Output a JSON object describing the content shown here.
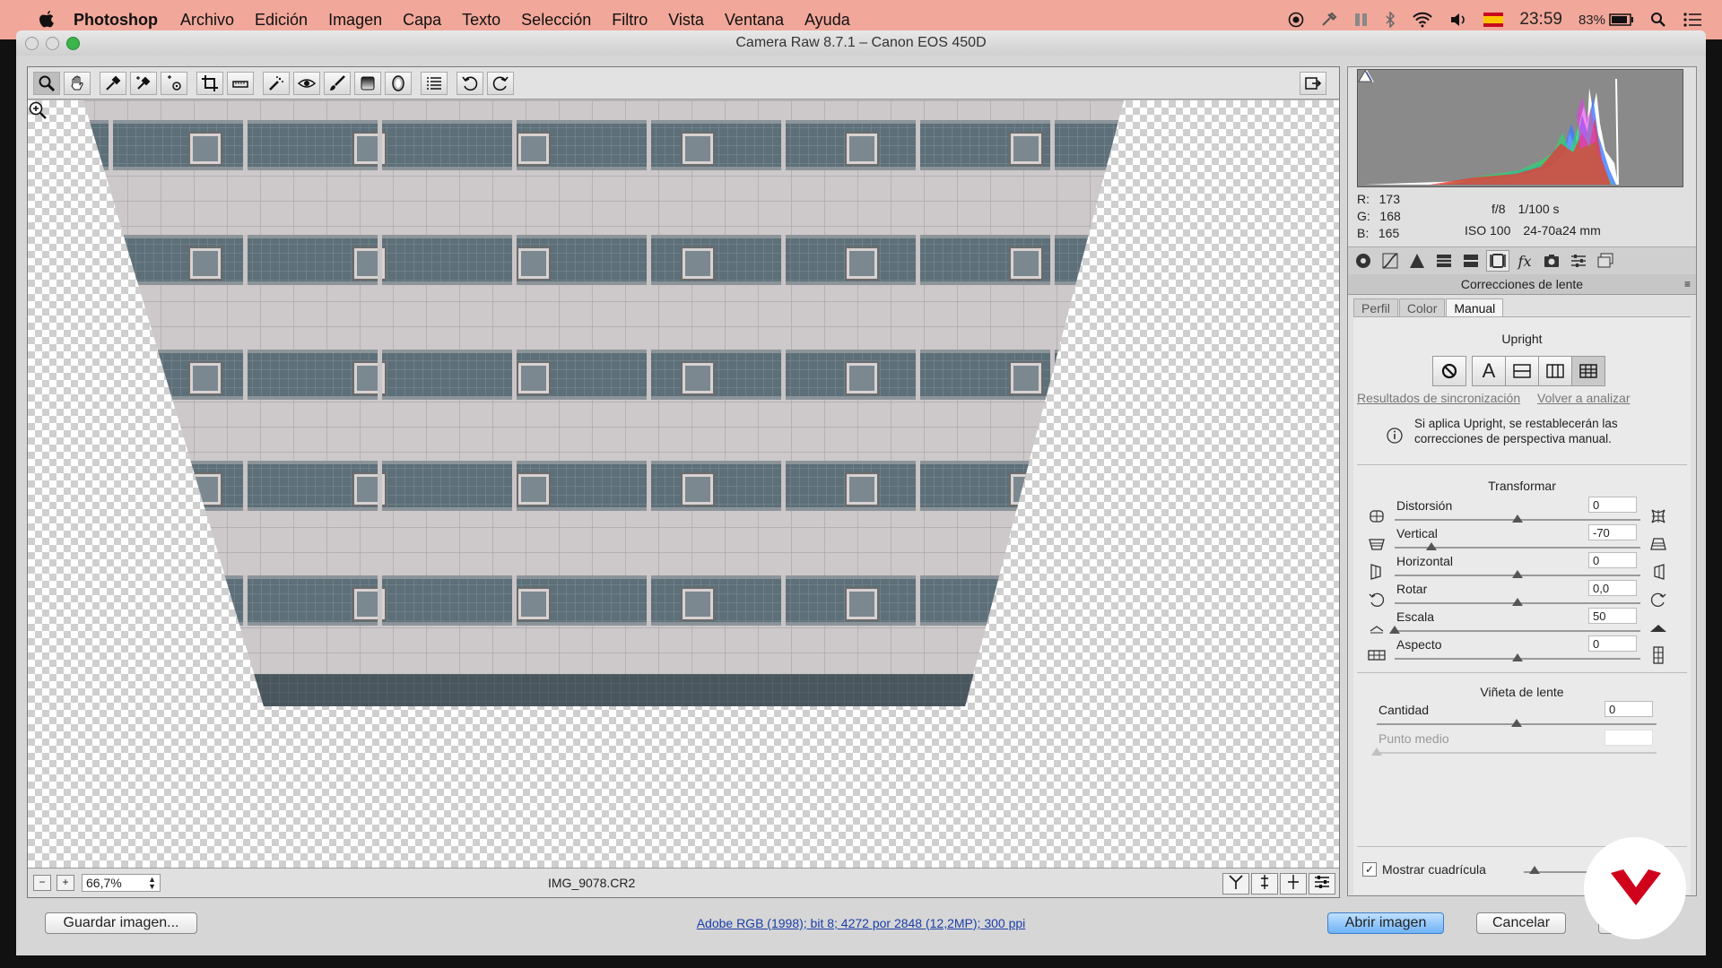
{
  "menubar": {
    "app_name": "Photoshop",
    "items": [
      "Archivo",
      "Edición",
      "Imagen",
      "Capa",
      "Texto",
      "Selección",
      "Filtro",
      "Vista",
      "Ventana",
      "Ayuda"
    ],
    "clock": "23:59",
    "battery": "83%"
  },
  "window": {
    "title": "Camera Raw 8.7.1 –  Canon EOS 450D"
  },
  "preview": {
    "zoom": "66,7%",
    "filename": "IMG_9078.CR2"
  },
  "readout": {
    "r_label": "R:",
    "r": "173",
    "g_label": "G:",
    "g": "168",
    "b_label": "B:",
    "b": "165",
    "aperture": "f/8",
    "shutter": "1/100 s",
    "iso": "ISO 100",
    "lens": "24-70a24 mm"
  },
  "panel": {
    "section_title": "Correcciones de lente",
    "subtabs": [
      "Perfil",
      "Color",
      "Manual"
    ],
    "upright_title": "Upright",
    "sync_link": "Resultados de sincronización",
    "reanalyze_link": "Volver a analizar",
    "info_text": "Si aplica Upright, se restablecerán las correcciones de perspectiva manual.",
    "transform_title": "Transformar",
    "sliders": [
      {
        "label": "Distorsión",
        "value": "0",
        "level": 0.5
      },
      {
        "label": "Vertical",
        "value": "-70",
        "level": 0.15
      },
      {
        "label": "Horizontal",
        "value": "0",
        "level": 0.5
      },
      {
        "label": "Rotar",
        "value": "0,0",
        "level": 0.5
      },
      {
        "label": "Escala",
        "value": "50",
        "level": 0.0
      },
      {
        "label": "Aspecto",
        "value": "0",
        "level": 0.5
      }
    ],
    "vignette_title": "Viñeta de lente",
    "amount_label": "Cantidad",
    "amount_value": "0",
    "midpoint_label": "Punto medio",
    "grid_label": "Mostrar cuadrícula"
  },
  "bottom": {
    "save_label": "Guardar imagen...",
    "info_link": "Adobe RGB (1998); bit 8; 4272 por 2848 (12,2MP); 300 ppi",
    "open_label": "Abrir imagen",
    "cancel_label": "Cancelar"
  },
  "colors": {
    "menubar": "#f1a79a",
    "link": "#1a3ea8",
    "watermark": "#d0021b"
  }
}
